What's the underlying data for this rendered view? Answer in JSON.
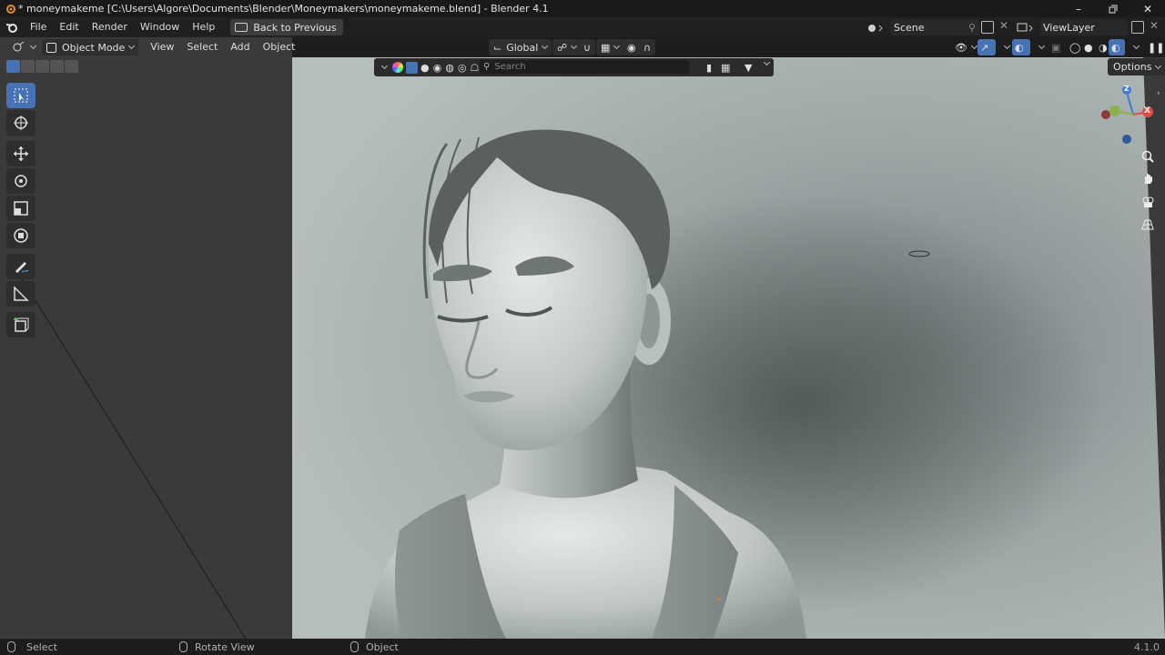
{
  "window": {
    "title": "* moneymakeme [C:\\Users\\Algore\\Documents\\Blender\\Moneymakers\\moneymakeme.blend] - Blender 4.1",
    "controls": [
      "minimize-icon",
      "restore-icon",
      "close-icon"
    ]
  },
  "menubar": {
    "items": [
      "File",
      "Edit",
      "Render",
      "Window",
      "Help"
    ],
    "back_button": "Back to Previous",
    "scene_label": "Scene",
    "viewlayer_label": "ViewLayer"
  },
  "viewport_header": {
    "mode": "Object Mode",
    "menus": [
      "View",
      "Select",
      "Add",
      "Object"
    ],
    "orientation": "Global",
    "options": "Options"
  },
  "filter_bar": {
    "search_placeholder": "Search"
  },
  "gizmo": {
    "z": "Z",
    "x": "X"
  },
  "statusbar": {
    "select": "Select",
    "rotate": "Rotate View",
    "object": "Object",
    "version": "4.1.0"
  },
  "colors": {
    "accent": "#4772b3",
    "panel": "#3a3a3a",
    "viewport_bg": "#8f9797",
    "axis_x": "#e24a4a",
    "axis_y": "#8bb34a",
    "axis_z": "#3f7ad8"
  }
}
